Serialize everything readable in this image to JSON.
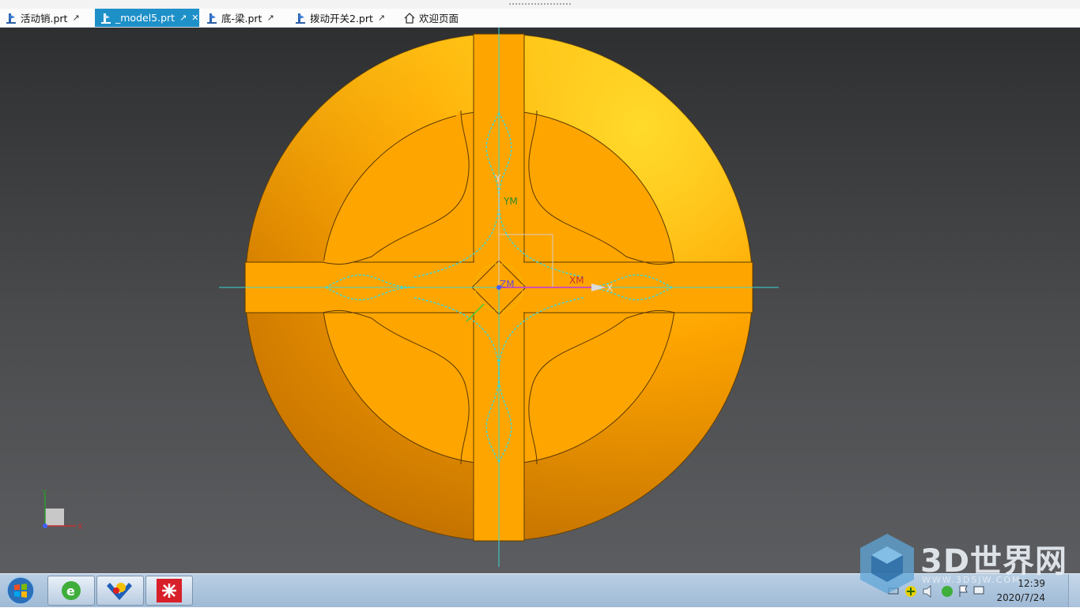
{
  "tabs": [
    {
      "label": "活动销.prt",
      "active": false,
      "icon": "part-file-icon",
      "action_icon": "popout-icon"
    },
    {
      "label": "_model5.prt",
      "active": true,
      "icon": "part-file-icon",
      "action_icon": "popout-icon",
      "close_icon": "close-icon"
    },
    {
      "label": "底-梁.prt",
      "active": false,
      "icon": "part-file-icon",
      "action_icon": "popout-icon"
    },
    {
      "label": "拨动开关2.prt",
      "active": false,
      "icon": "part-file-icon",
      "action_icon": "popout-icon"
    },
    {
      "label": "欢迎页面",
      "active": false,
      "icon": "home-icon"
    }
  ],
  "viewport": {
    "wcs_labels": {
      "y": "Y",
      "ym": "YM",
      "zm": "ZM",
      "xm": "XM",
      "x": "X"
    },
    "triad_labels": {
      "y": "Y",
      "x": "X"
    },
    "colors": {
      "part_light": "#ffe033",
      "part_mid": "#ffa500",
      "part_dark": "#c67200",
      "csys_line": "#39d6d6",
      "background_top": "#2e2f31",
      "background_bottom": "#5c5d60"
    }
  },
  "taskbar": {
    "apps": [
      {
        "name": "start-orb-icon"
      },
      {
        "name": "ie-browser-icon"
      },
      {
        "name": "nx-app-icon"
      },
      {
        "name": "red-app-icon"
      }
    ],
    "clock": {
      "time": "12:39",
      "date": "2020/7/24"
    }
  },
  "watermark": {
    "title": "3D世界网",
    "sub": "WWW.3DSJW.COM"
  }
}
